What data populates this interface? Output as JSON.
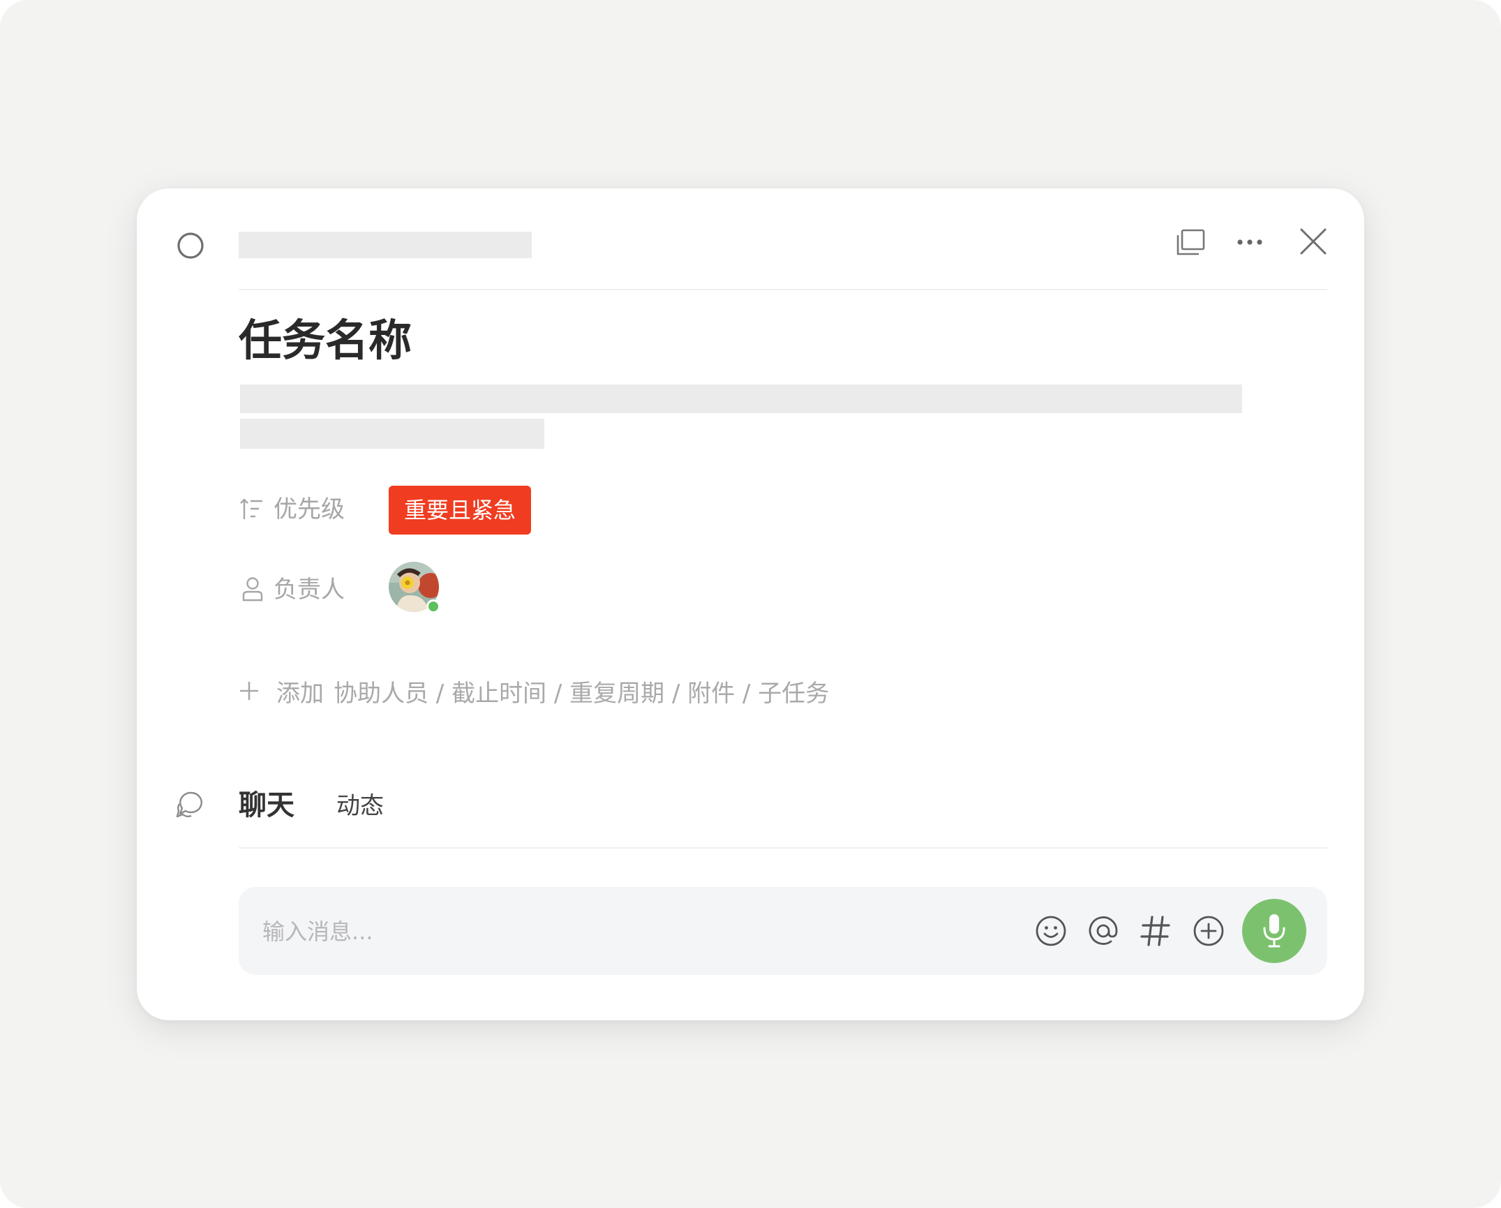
{
  "task": {
    "title": "任务名称"
  },
  "fields": {
    "priority": {
      "label": "优先级",
      "value": "重要且紧急",
      "value_color": "#f03c20"
    },
    "assignee": {
      "label": "负责人",
      "status_color": "#5dc05a"
    }
  },
  "add_row": {
    "prefix": "添加",
    "items": "协助人员 / 截止时间 / 重复周期 / 附件 / 子任务"
  },
  "tabs": [
    {
      "label": "聊天",
      "active": true
    },
    {
      "label": "动态",
      "active": false
    }
  ],
  "composer": {
    "placeholder": "输入消息...",
    "mic_color": "#7cc26e"
  },
  "icons": {
    "complete": "circle-check-icon",
    "window": "window-restore-icon",
    "more": "more-icon",
    "close": "close-icon",
    "priority": "priority-icon",
    "assignee": "user-icon",
    "add": "plus-icon",
    "chat": "chat-bubble-icon",
    "emoji": "emoji-icon",
    "mention": "at-icon",
    "topic": "hashtag-icon",
    "attach": "plus-circle-icon",
    "mic": "microphone-icon"
  }
}
